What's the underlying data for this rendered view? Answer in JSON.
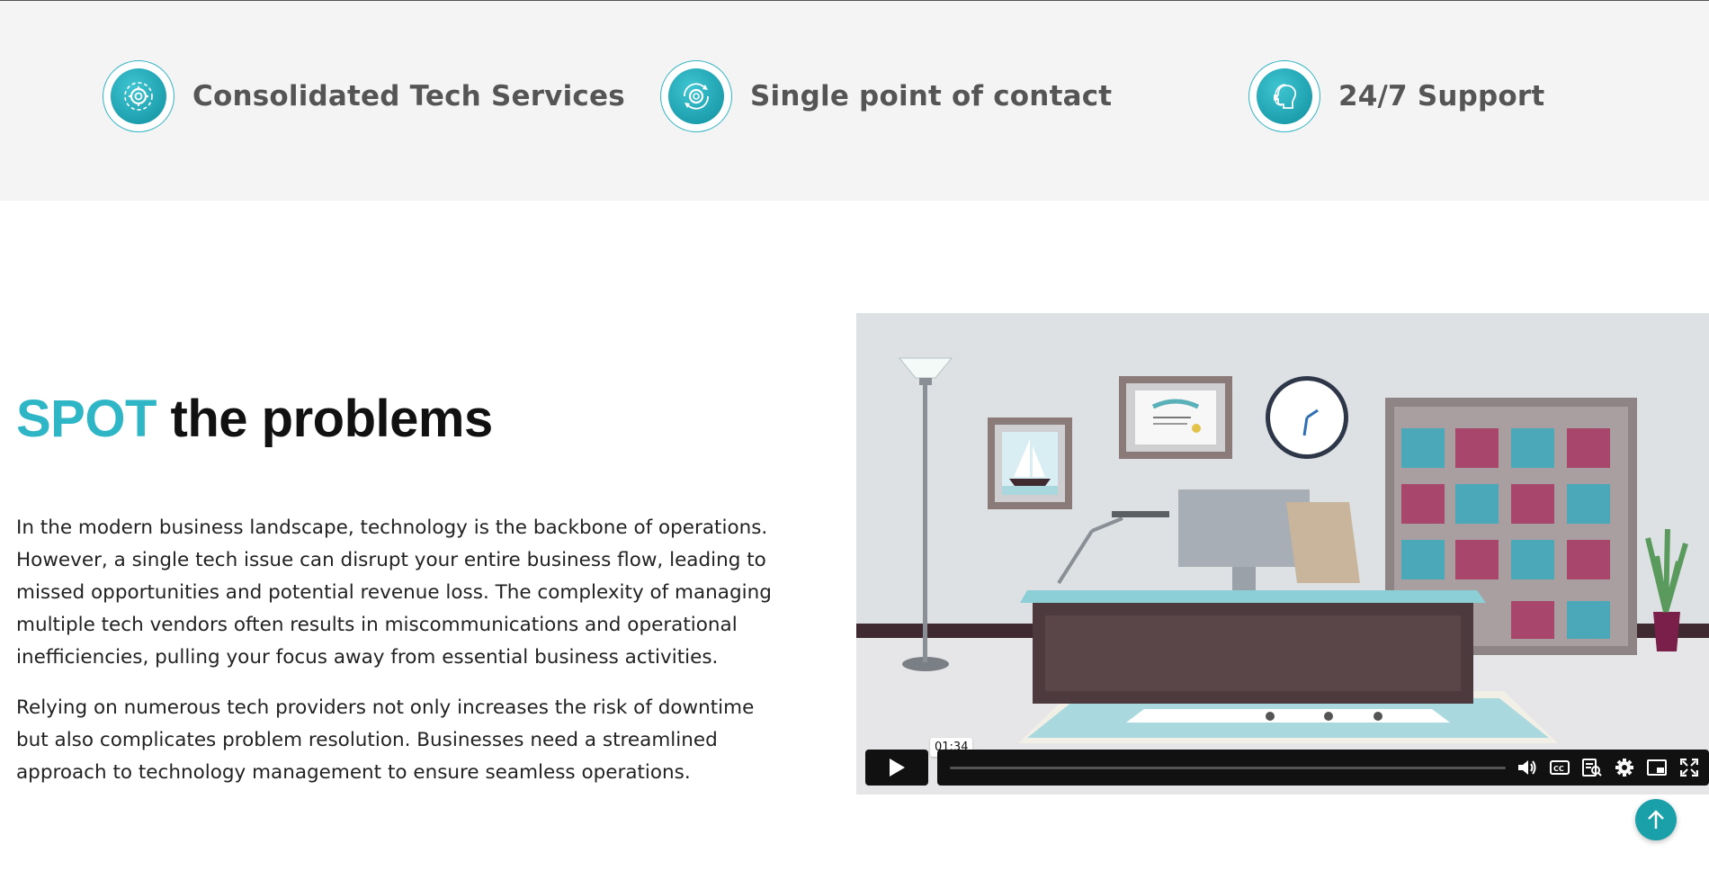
{
  "features": [
    {
      "label": "Consolidated Tech Services",
      "icon": "gear-cog-icon"
    },
    {
      "label": "Single point of contact",
      "icon": "gear-cycle-icon"
    },
    {
      "label": "24/7 Support",
      "icon": "headset-person-icon"
    }
  ],
  "problems": {
    "title_accent": "SPOT",
    "title_rest": " the problems",
    "paragraph_1": "In the modern business landscape, technology is the backbone of operations. However, a single tech issue can disrupt your entire business flow, leading to missed opportunities and potential revenue loss. The complexity of managing multiple tech vendors often results in miscommunications and operational inefficiencies, pulling your focus away from essential business activities.",
    "paragraph_2": "Relying on numerous tech providers not only increases the risk of downtime but also complicates problem resolution. Businesses need a streamlined approach to technology management to ensure seamless operations."
  },
  "video": {
    "time_tooltip": "01:34",
    "controls": [
      "play-icon",
      "volume-icon",
      "captions-icon",
      "transcript-icon",
      "settings-icon",
      "picture-in-picture-icon",
      "fullscreen-icon"
    ]
  },
  "colors": {
    "accent": "#2eb6c6",
    "feature_icon": "#1aa0b0",
    "scroll_top": "#1aa0a8"
  }
}
